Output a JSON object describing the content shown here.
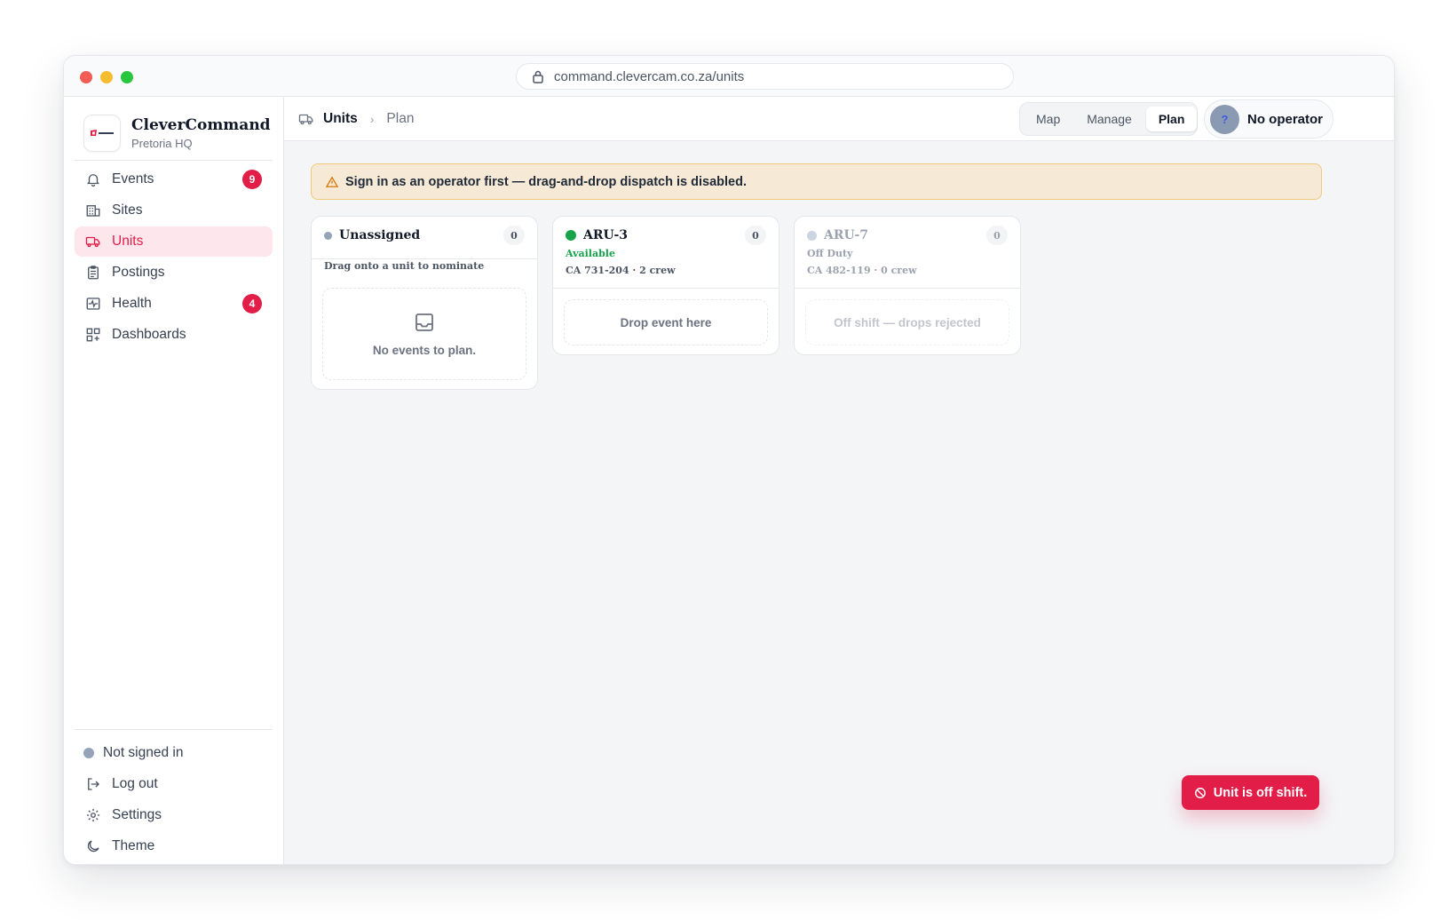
{
  "browser": {
    "url": "command.clevercam.co.za/units"
  },
  "brand": {
    "title": "CleverCommand",
    "subtitle": "Pretoria HQ"
  },
  "sidebar": {
    "items": [
      {
        "label": "Events",
        "icon": "bell-icon",
        "badge": "9"
      },
      {
        "label": "Sites",
        "icon": "building-icon"
      },
      {
        "label": "Units",
        "icon": "truck-icon",
        "active": true
      },
      {
        "label": "Postings",
        "icon": "clipboard-icon"
      },
      {
        "label": "Health",
        "icon": "pulse-icon",
        "badge": "4"
      },
      {
        "label": "Dashboards",
        "icon": "grid-plus-icon"
      }
    ],
    "footer": {
      "status": "Not signed in",
      "logout": "Log out",
      "settings": "Settings",
      "theme": "Theme"
    }
  },
  "header": {
    "crumb_root": "Units",
    "crumb_current": "Plan",
    "views": [
      "Map",
      "Manage",
      "Plan"
    ],
    "active_view": "Plan",
    "operator_avatar": "?",
    "operator_label": "No operator"
  },
  "alert": {
    "text": "Sign in as an operator first — drag-and-drop dispatch is disabled."
  },
  "columns": [
    {
      "title": "Unassigned",
      "count": "0",
      "subtitle": "Drag onto a unit to nominate",
      "empty": "No events to plan.",
      "dot_color": "#94a3b8"
    },
    {
      "title": "ARU-3",
      "count": "0",
      "status": "Available",
      "status_color": "#16a34a",
      "meta": "CA 731-204 · 2 crew",
      "drop": "Drop event here",
      "dot_color": "#16a34a"
    },
    {
      "title": "ARU-7",
      "count": "0",
      "status": "Off Duty",
      "meta": "CA 482-119 · 0 crew",
      "drop": "Off shift — drops rejected",
      "dot_color": "#cbd5e1"
    }
  ],
  "toast": {
    "text": "Unit is off shift."
  },
  "colors": {
    "accent": "#e11d48",
    "available": "#16a34a",
    "warning_bg": "#f6ead7"
  }
}
